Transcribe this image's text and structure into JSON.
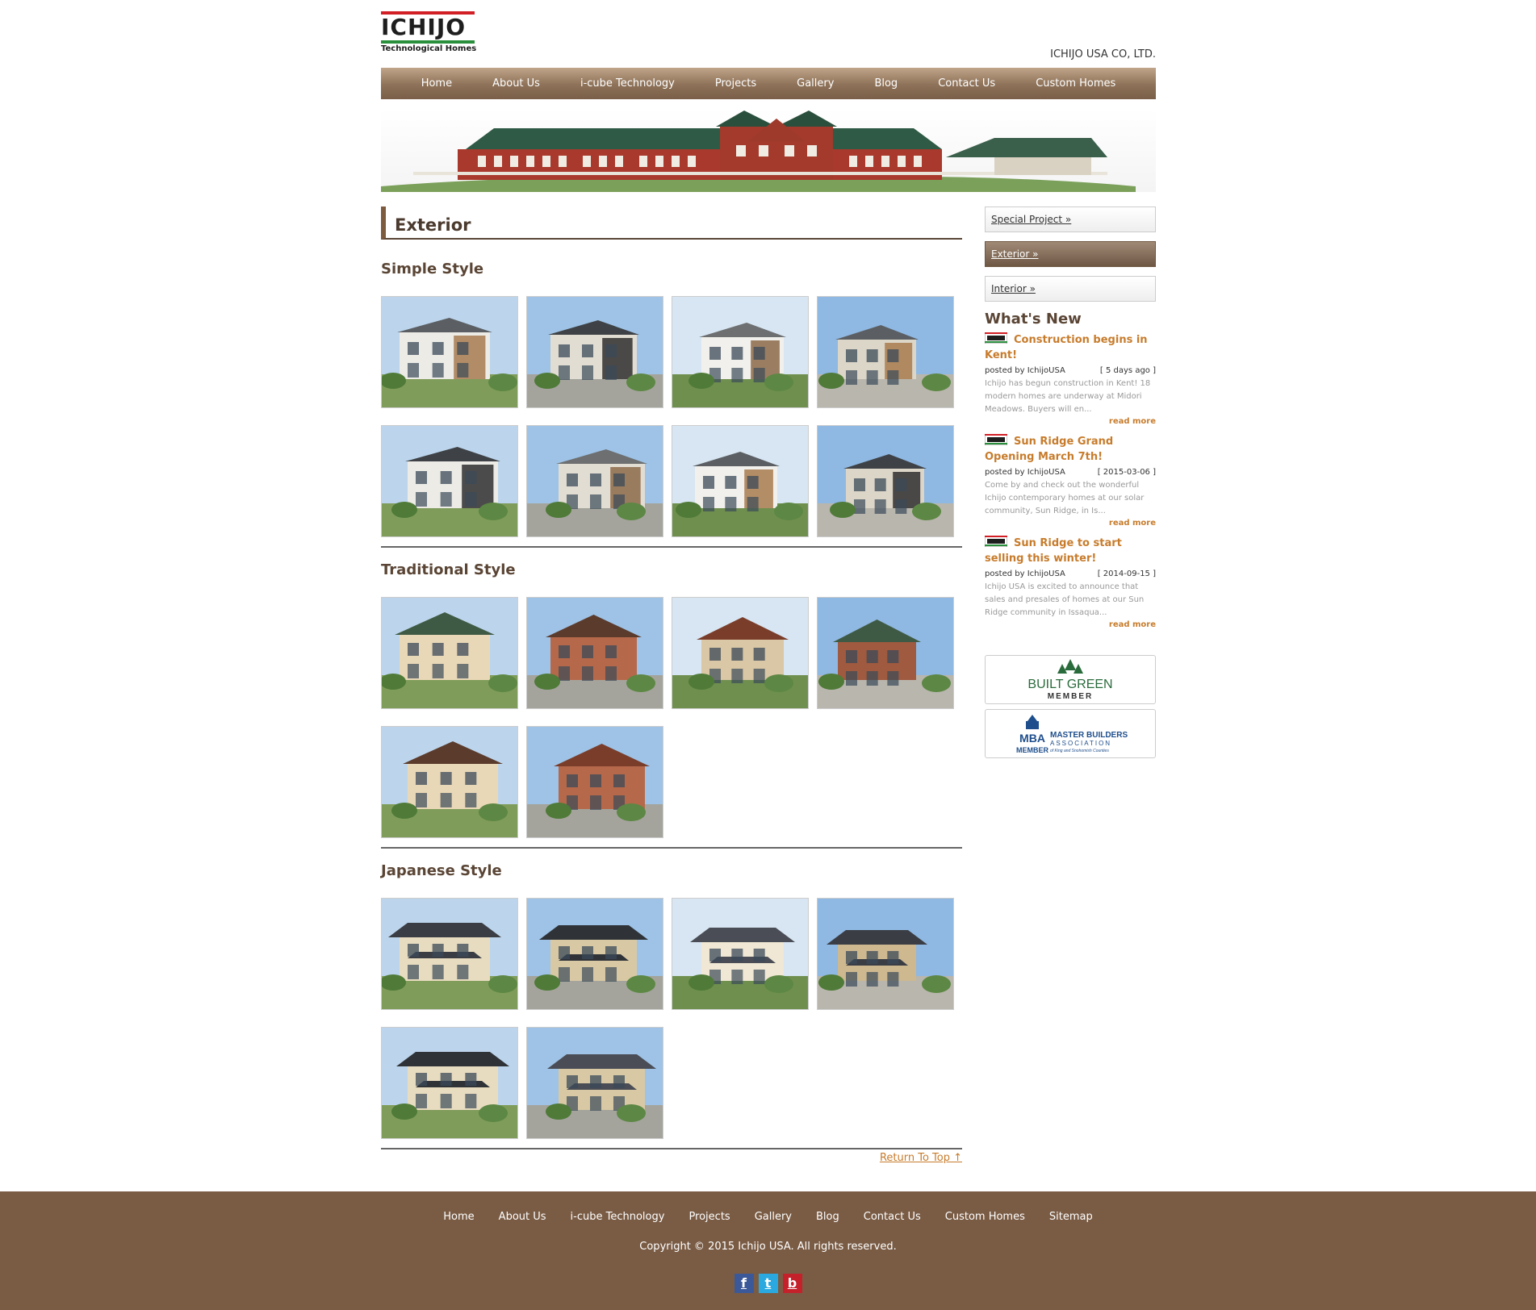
{
  "header": {
    "logo_text": "ICHIJO",
    "logo_sub": "Technological Homes",
    "company": "ICHIJO USA CO, LTD."
  },
  "nav": [
    "Home",
    "About Us",
    "i-cube Technology",
    "Projects",
    "Gallery",
    "Blog",
    "Contact Us",
    "Custom Homes"
  ],
  "main": {
    "page_title": "Exterior",
    "sections": [
      {
        "title": "Simple Style",
        "image_count": 8
      },
      {
        "title": "Traditional Style",
        "image_count": 6
      },
      {
        "title": "Japanese Style",
        "image_count": 6
      }
    ],
    "return_top": "Return To Top ↑"
  },
  "sidebar": {
    "links": [
      "Special Project »",
      "Exterior »",
      "Interior »"
    ],
    "active_link": "Exterior »",
    "whats_new_title": "What's New",
    "news": [
      {
        "title": "Construction begins in Kent!",
        "author": "posted by IchijoUSA",
        "date": "[ 5 days ago ]",
        "excerpt": "Ichijo has begun construction in Kent! 18 modern homes are underway at Midori Meadows. Buyers will en...",
        "more": "read more"
      },
      {
        "title": "Sun Ridge Grand Opening March 7th!",
        "author": "posted by IchijoUSA",
        "date": "[ 2015-03-06 ]",
        "excerpt": "Come by and check out the wonderful Ichijo contemporary homes at our solar community, Sun Ridge, in Is...",
        "more": "read more"
      },
      {
        "title": "Sun Ridge to start selling this winter!",
        "author": "posted by IchijoUSA",
        "date": "[ 2014-09-15 ]",
        "excerpt": "Ichijo USA is excited to announce that sales and presales of homes at our Sun Ridge community in Issaqua...",
        "more": "read more"
      }
    ],
    "badges": [
      {
        "line1": "BUILT GREEN",
        "line2": "MEMBER"
      },
      {
        "line1": "MASTER BUILDERS",
        "line2": "ASSOCIATION",
        "line3": "MEMBER",
        "abbr": "MBA",
        "sub": "of King and Snohomish Counties"
      }
    ]
  },
  "footer": {
    "links": [
      "Home",
      "About Us",
      "i-cube Technology",
      "Projects",
      "Gallery",
      "Blog",
      "Contact Us",
      "Custom Homes",
      "Sitemap"
    ],
    "copyright": "Copyright © 2015 Ichijo USA. All rights reserved.",
    "social": [
      {
        "icon": "facebook-icon",
        "glyph": "f",
        "color": "#3b5998"
      },
      {
        "icon": "twitter-icon",
        "glyph": "t",
        "color": "#2aa9e0"
      },
      {
        "icon": "blog-icon",
        "glyph": "b",
        "color": "#c4212b"
      }
    ]
  },
  "colors": {
    "nav": "#8d7158",
    "footer": "#7a5c45",
    "accent": "#c77c2c",
    "title": "#5a4535"
  }
}
